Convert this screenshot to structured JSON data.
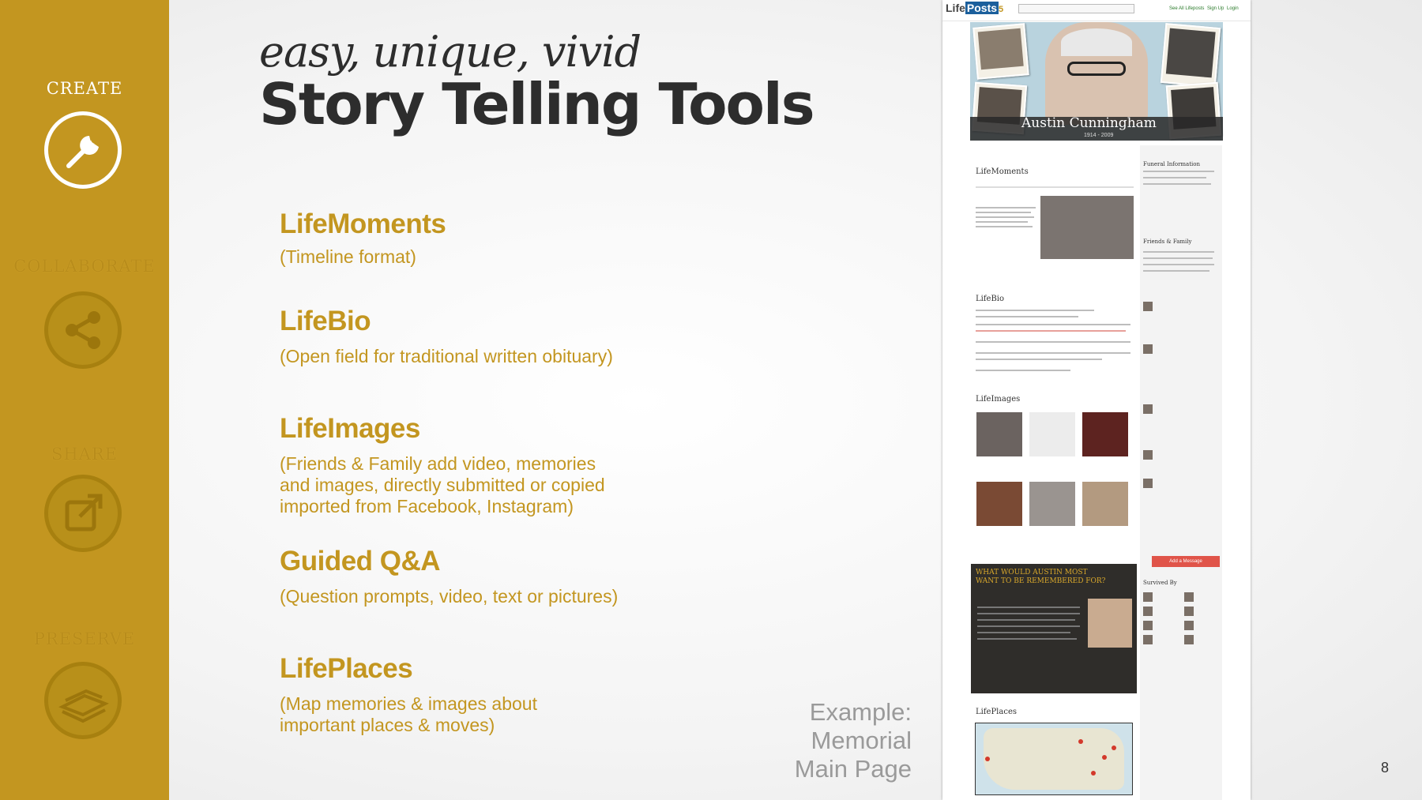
{
  "sidebar": {
    "items": [
      {
        "label": "CREATE",
        "icon": "wrench-icon",
        "active": true
      },
      {
        "label": "COLLABORATE",
        "icon": "share-nodes-icon",
        "active": false
      },
      {
        "label": "SHARE",
        "icon": "external-link-icon",
        "active": false
      },
      {
        "label": "PRESERVE",
        "icon": "book-stack-icon",
        "active": false
      }
    ]
  },
  "header": {
    "tagline": "easy, unique, vivid",
    "title": "Story Telling Tools"
  },
  "features": [
    {
      "title": "LifeMoments",
      "desc": [
        "(Timeline format)"
      ]
    },
    {
      "title": "LifeBio",
      "desc": [
        "(Open field for traditional written obituary)"
      ]
    },
    {
      "title": "LifeImages",
      "desc": [
        "(Friends & Family add video, memories",
        "and images, directly submitted or copied",
        "imported from Facebook, Instagram)"
      ]
    },
    {
      "title": "Guided Q&A",
      "desc": [
        "(Question prompts, video, text or pictures)"
      ]
    },
    {
      "title": "LifePlaces",
      "desc": [
        "(Map memories & images about",
        "important places & moves)"
      ]
    }
  ],
  "leader_dots": ". . . . . . . . . . . . .",
  "example": {
    "lines": [
      "Example:",
      "Memorial",
      "Main Page"
    ]
  },
  "page_number": "8",
  "mock_page": {
    "logo_main": "Life",
    "logo_box": "Posts",
    "logo_tag": "5",
    "header_links": [
      "See All Lifeposts",
      "Sign Up",
      "Login"
    ],
    "person_name": "Austin Cunningham",
    "person_dates": "1914 - 2009",
    "sections": {
      "moments": "LifeMoments",
      "bio": "LifeBio",
      "images": "LifeImages",
      "places": "LifePlaces",
      "funeral": "Funeral Information",
      "friends": "Friends & Family",
      "survived": "Survived By"
    },
    "qa_title": "WHAT WOULD AUSTIN MOST WANT TO BE REMEMBERED FOR?",
    "add_message": "Add a Message"
  },
  "colors": {
    "accent": "#c39620",
    "sidebar": "#c39620",
    "title": "#2d2d2d"
  }
}
